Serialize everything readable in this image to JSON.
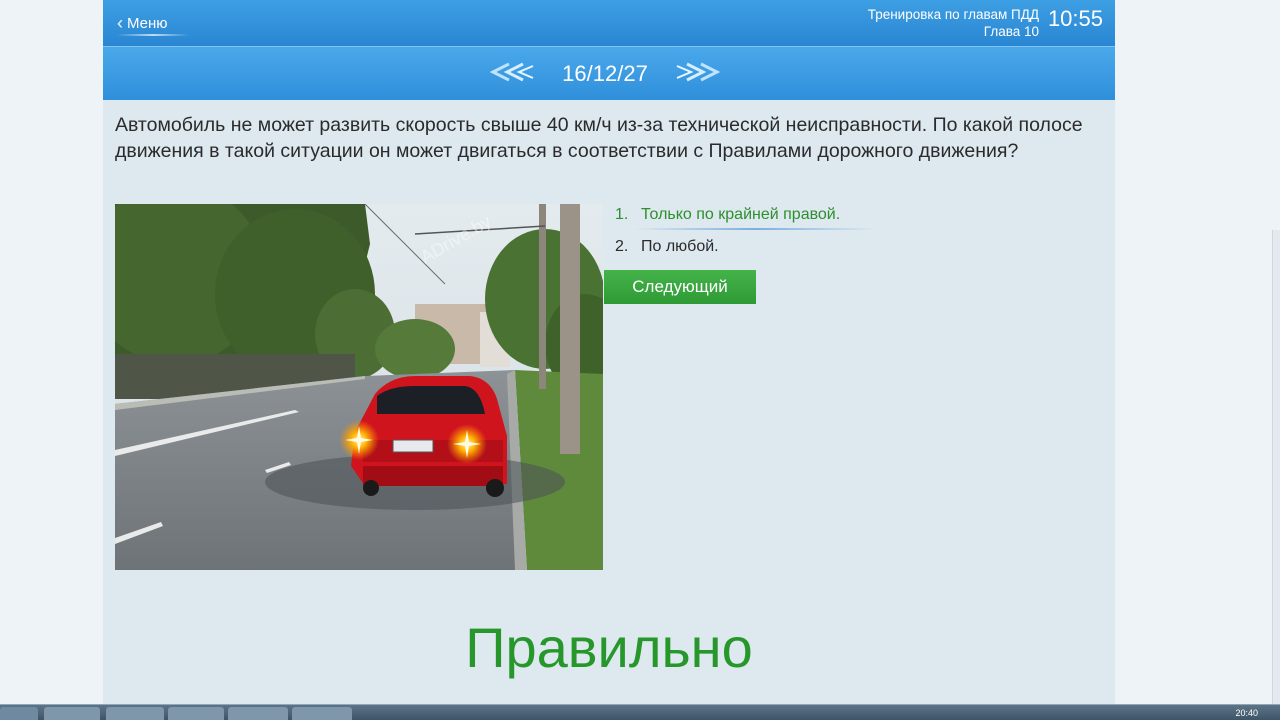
{
  "topbar": {
    "menu_label": "Меню",
    "mode_title": "Тренировка по главам ПДД",
    "chapter": "Глава 10",
    "clock": "10:55"
  },
  "nav": {
    "counter": "16/12/27"
  },
  "question": {
    "text": "Автомобиль не может развить скорость свыше 40 км/ч из-за технической неисправности. По какой полосе движения в такой ситуации он может двигаться в соответствии с Правилами дорожного движения?"
  },
  "image": {
    "watermark": "ADrive.by"
  },
  "answers": [
    {
      "num": "1.",
      "text": "Только по крайней правой.",
      "state": "correct"
    },
    {
      "num": "2.",
      "text": "По любой.",
      "state": "neutral"
    }
  ],
  "next_button": {
    "label": "Следующий"
  },
  "result": {
    "text": "Правильно"
  },
  "taskbar": {
    "time": "20:40"
  },
  "colors": {
    "topbar_blue": "#2a86d2",
    "correct_green": "#2e8f2e",
    "next_button_green": "#3aa83f",
    "background": "#dde8ef"
  }
}
